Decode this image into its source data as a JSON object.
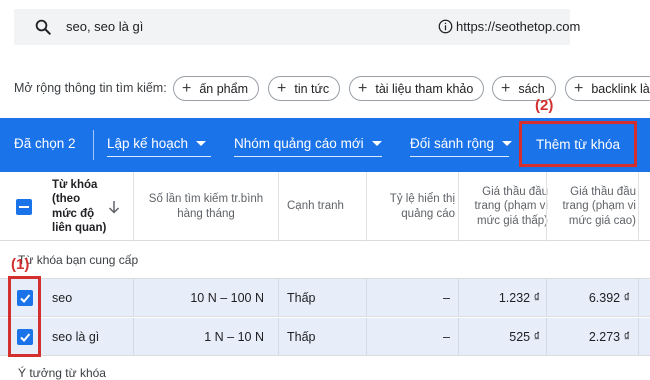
{
  "search": {
    "query": "seo, seo là gì",
    "url": "https://seothetop.com"
  },
  "expand": {
    "label": "Mở rộng thông tin tìm kiếm:",
    "chips": [
      "ấn phẩm",
      "tin tức",
      "tài liệu tham khảo",
      "sách",
      "backlink là"
    ]
  },
  "annotations": {
    "a1": "(1)",
    "a2": "(2)"
  },
  "toolbar": {
    "selected": "Đã chọn 2",
    "plan": "Lập kế hoạch",
    "new_ad_group": "Nhóm quảng cáo mới",
    "broad_match": "Đối sánh rộng",
    "add_keywords": "Thêm từ khóa"
  },
  "table": {
    "headers": {
      "keyword": [
        "Từ khóa",
        "(theo",
        "mức độ",
        "liên quan)"
      ],
      "searches": [
        "Số lần tìm kiếm tr.bình",
        "hàng tháng"
      ],
      "competition": "Cạnh tranh",
      "impression_share": [
        "Tỷ lệ hiển thị",
        "quảng cáo"
      ],
      "bid_low": [
        "Giá thầu đầu",
        "trang (phạm vi",
        "mức giá thấp)"
      ],
      "bid_high": [
        "Giá thầu đầu",
        "trang (phạm vi",
        "mức giá cao)"
      ]
    },
    "group_provided": "Từ khóa bạn cung cấp",
    "group_ideas": "Ý tưởng từ khóa",
    "rows": [
      {
        "keyword": "seo",
        "searches": "10 N – 100 N",
        "competition": "Thấp",
        "impression_share": "–",
        "bid_low": "1.232 ₫",
        "bid_high": "6.392 ₫"
      },
      {
        "keyword": "seo là gì",
        "searches": "1 N – 10 N",
        "competition": "Thấp",
        "impression_share": "–",
        "bid_low": "525 ₫",
        "bid_high": "2.273 ₫"
      }
    ]
  },
  "colors": {
    "primary": "#1a73e8",
    "annotation": "#d32f2f",
    "row_selected": "#e8eef9"
  }
}
